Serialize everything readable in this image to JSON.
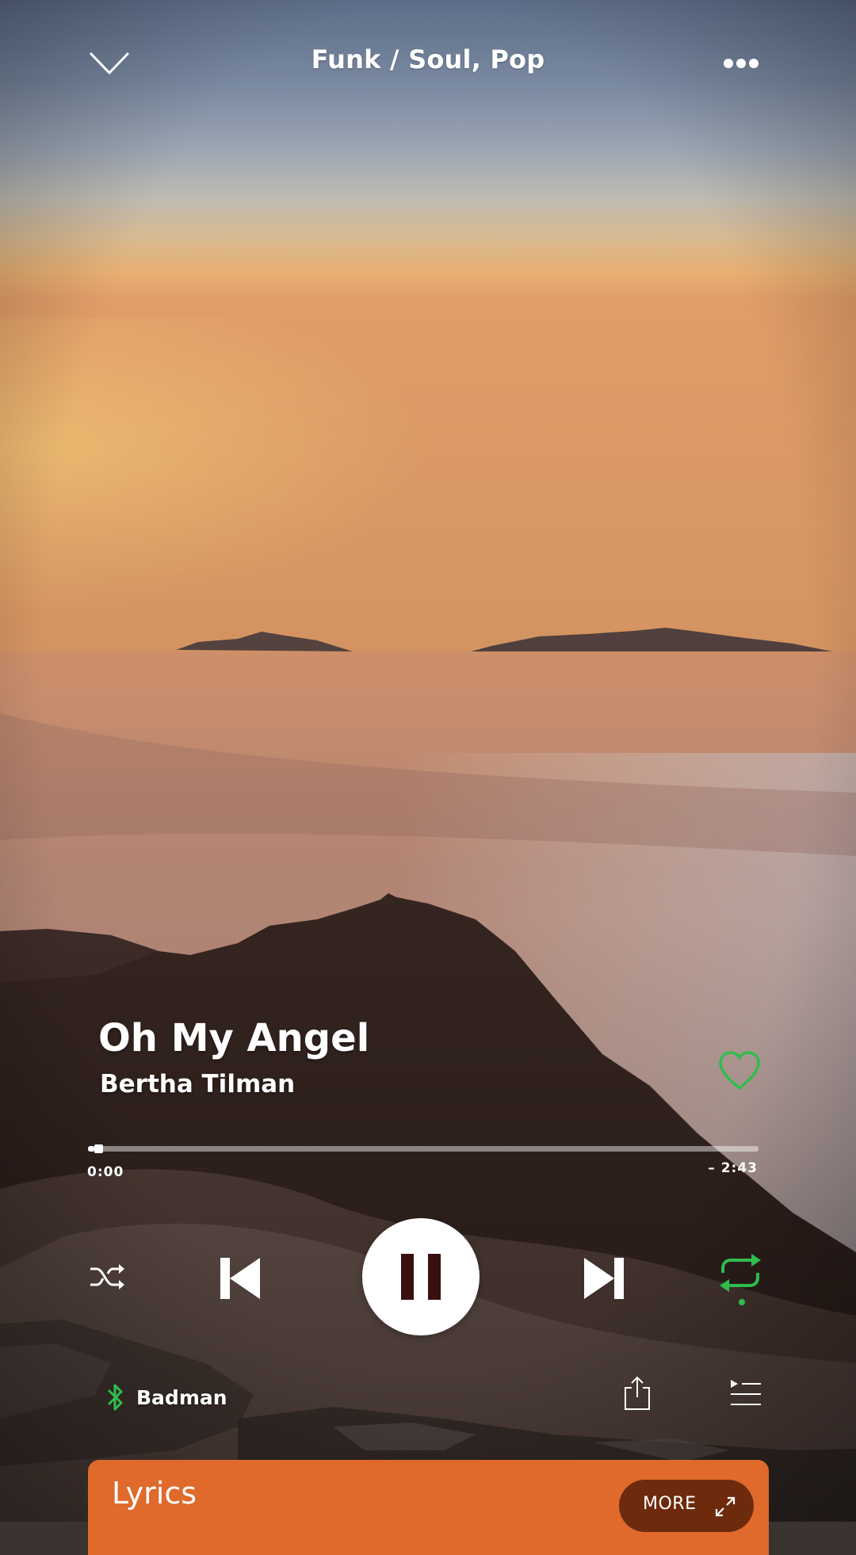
{
  "header": {
    "title": "Funk / Soul, Pop",
    "collapse_icon": "chevron-down-icon",
    "menu_icon": "more-horizontal-icon"
  },
  "track": {
    "title": "Oh My Angel",
    "artist": "Bertha Tilman",
    "liked": false
  },
  "progress": {
    "elapsed": "0:00",
    "remaining": "– 2:43",
    "fraction": 0.01
  },
  "controls": {
    "shuffle_icon": "shuffle-icon",
    "previous_icon": "skip-previous-icon",
    "play_state": "playing",
    "pause_icon": "pause-icon",
    "next_icon": "skip-next-icon",
    "repeat_icon": "repeat-icon",
    "repeat_active": true
  },
  "footer": {
    "device_icon": "bluetooth-icon",
    "device_name": "Badman",
    "share_icon": "share-icon",
    "queue_icon": "queue-icon"
  },
  "lyrics": {
    "title": "Lyrics",
    "more_label": "MORE",
    "expand_icon": "expand-icon"
  },
  "colors": {
    "accent_green": "#2fbd4c",
    "lyrics_card": "#df6a2c",
    "more_button": "#6d2a0d",
    "pause_glyph": "#3a0f0f"
  }
}
